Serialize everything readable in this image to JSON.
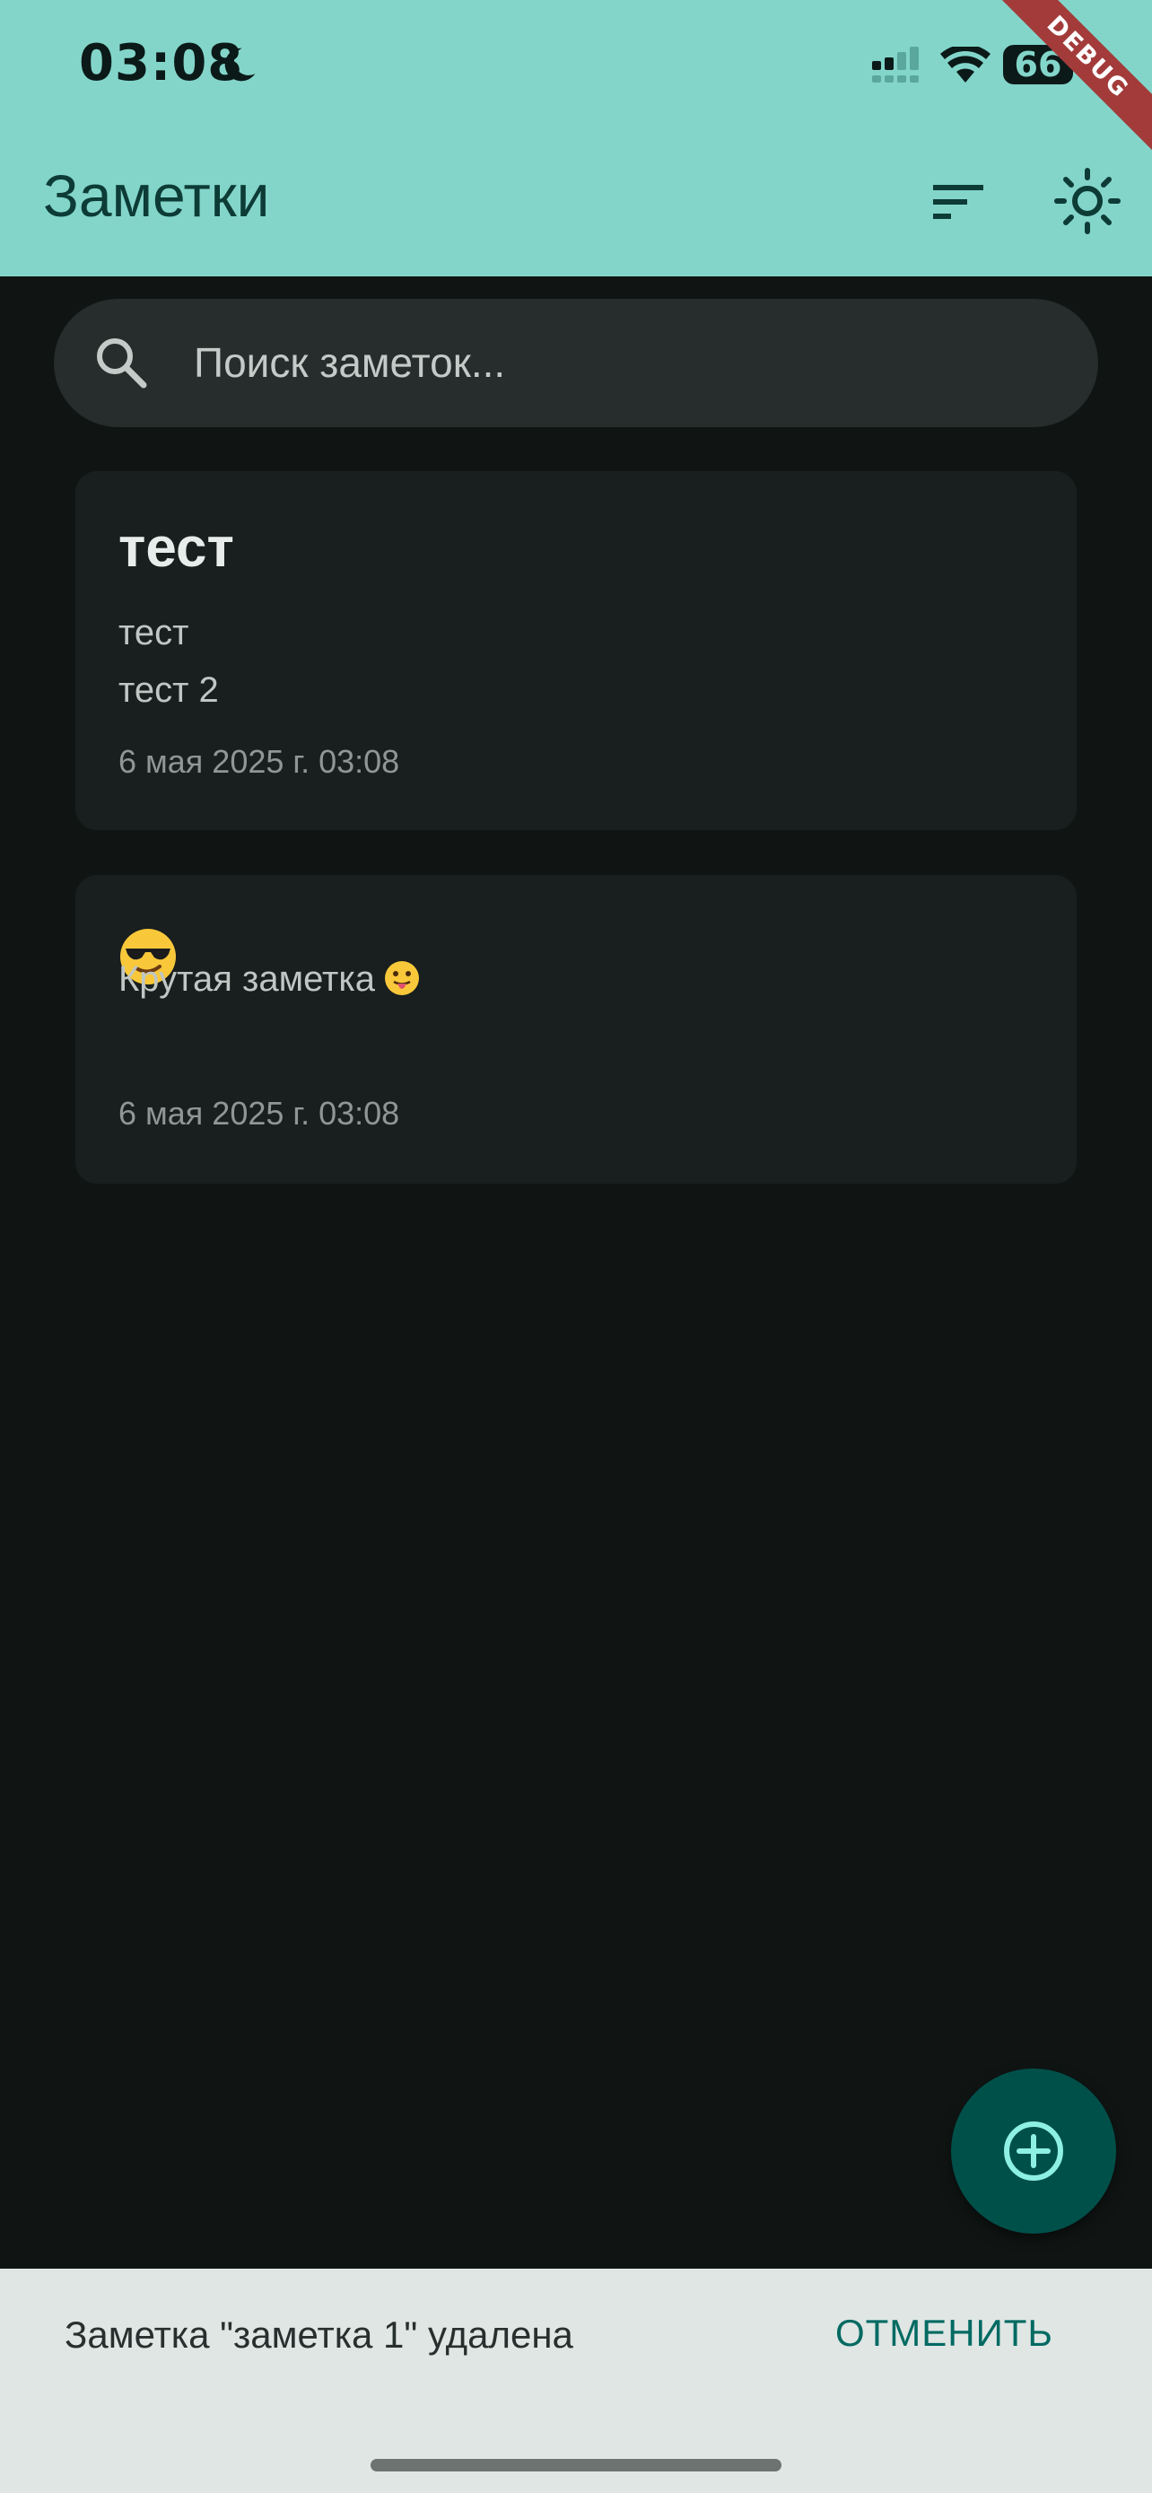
{
  "status_bar": {
    "time": "03:08",
    "battery": "66",
    "debug_banner": "DEBUG"
  },
  "app_bar": {
    "title": "Заметки",
    "sort_icon": "sort-icon",
    "theme_icon": "sun-icon"
  },
  "search": {
    "placeholder": "Поиск заметок..."
  },
  "notes": [
    {
      "title": "тест",
      "body_lines": [
        "тест",
        "тест 2"
      ],
      "date": "6 мая 2025 г. 03:08"
    },
    {
      "title_emoji": "😎",
      "body": "Крутая заметка",
      "body_emoji": "😛",
      "date": "6 мая 2025 г. 03:08"
    }
  ],
  "fab": {
    "icon": "add-circle-icon"
  },
  "snackbar": {
    "message": "Заметка \"заметка 1\" удалена",
    "action": "ОТМЕНИТЬ"
  },
  "colors": {
    "app_bar": "#83d5ca",
    "background": "#101514",
    "card": "#191e1e",
    "fab": "#00504a",
    "snackbar": "#dfe6e4",
    "accent_text": "#006a62"
  }
}
